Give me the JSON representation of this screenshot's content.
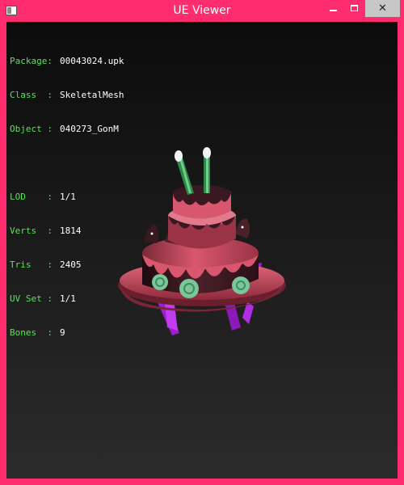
{
  "window": {
    "title": "UE Viewer",
    "icons": {
      "app": "app-window-icon",
      "minimize": "minimize-icon",
      "maximize": "maximize-icon",
      "close": "close-icon"
    },
    "close_glyph": "✕"
  },
  "info": {
    "package": {
      "label": "Package:",
      "value": "00043024.upk"
    },
    "class": {
      "label": "Class  :",
      "value": "SkeletalMesh"
    },
    "object": {
      "label": "Object :",
      "value": "040273_GonM"
    },
    "lod": {
      "label": "LOD    :",
      "value": "1/1"
    },
    "verts": {
      "label": "Verts  :",
      "value": "1814"
    },
    "tris": {
      "label": "Tris   :",
      "value": "2405"
    },
    "uvset": {
      "label": "UV Set :",
      "value": "1/1"
    },
    "bones": {
      "label": "Bones  :",
      "value": "9"
    }
  },
  "colors": {
    "frame": "#ff2d6f",
    "info_label": "#54e654",
    "info_value": "#ffffff",
    "cake_pink": "#d9566f",
    "chocolate": "#3a1820",
    "swirl_green": "#79c79a",
    "candle_green": "#2f8a4a",
    "crystal_purple": "#9b1fcf"
  }
}
